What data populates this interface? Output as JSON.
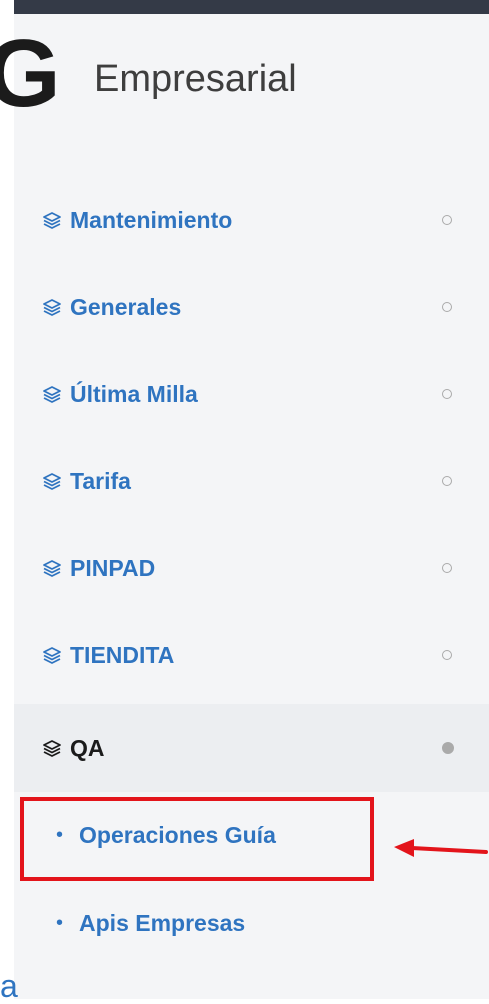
{
  "brand": {
    "logo_letter": "G",
    "title": "Empresarial"
  },
  "menu": [
    {
      "label": "Mantenimiento",
      "icon": "layers-icon",
      "active": false
    },
    {
      "label": "Generales",
      "icon": "layers-icon",
      "active": false
    },
    {
      "label": "Última Milla",
      "icon": "layers-icon",
      "active": false
    },
    {
      "label": "Tarifa",
      "icon": "layers-icon",
      "active": false
    },
    {
      "label": "PINPAD",
      "icon": "layers-icon",
      "active": false
    },
    {
      "label": "TIENDITA",
      "icon": "layers-icon",
      "active": false
    },
    {
      "label": "QA",
      "icon": "layers-icon",
      "active": true
    }
  ],
  "submenu": [
    {
      "label": "Operaciones Guía",
      "bullet": "•",
      "highlighted": true
    },
    {
      "label": "Apis Empresas",
      "bullet": "•",
      "highlighted": false
    }
  ],
  "corner_text": "a",
  "colors": {
    "link": "#2f74c0",
    "highlight": "#e3141b",
    "topbar": "#343a47",
    "sidebar_bg": "#f4f5f7"
  }
}
